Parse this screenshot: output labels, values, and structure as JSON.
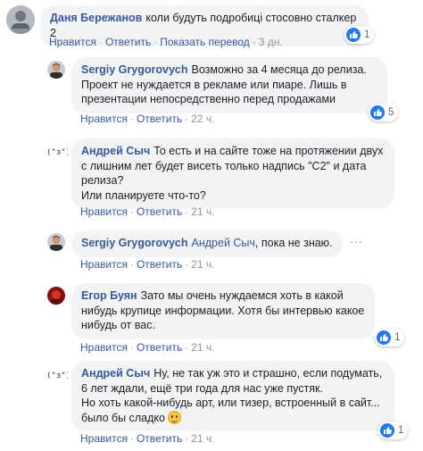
{
  "actions": {
    "like": "Нравится",
    "reply": "Ответить",
    "translate": "Показать перевод",
    "separator": "·"
  },
  "colors": {
    "link": "#385898",
    "like_badge": "#2078f4",
    "bubble": "#f2f3f5"
  },
  "comments": [
    {
      "author": "Даня Бережанов",
      "text": "коли будуть подробиці стосовно сталкер 2",
      "time": "3 дн.",
      "reactions": "1",
      "avatar": "gray-photo-avatar"
    },
    {
      "author": "Sergiy Grygorovych",
      "text": "Возможно за 4 месяца до релиза. Проект не нуждается в рекламе или пиаре. Лишь в презентации непосредственно перед продажами",
      "time": "22 ч.",
      "reactions": "5",
      "avatar": "man-photo-avatar"
    },
    {
      "author": "Андрей Сыч",
      "text": "То есть и на сайте тоже на протяжении двух с лишним лет будет висеть только надпись \"С2\" и дата релиза?\nИли планируете что-то?",
      "time": "21 ч.",
      "avatar": "ascii-face-avatar",
      "avatar_text": "(\"з\")"
    },
    {
      "author": "Sergiy Grygorovych",
      "mention": "Андрей Сыч",
      "text": ", пока не знаю.",
      "time": "21 ч.",
      "avatar": "man-photo-avatar"
    },
    {
      "author": "Егор Буян",
      "text": "Зато мы очень нуждаемся хоть в какой нибудь крупице информации. Хотя бы интервью какое нибудь от вас.",
      "time": "21 ч.",
      "reactions": "1",
      "avatar": "red-photo-avatar"
    },
    {
      "author": "Андрей Сыч",
      "text": "Ну, не так уж это и страшно, если подумать, 6 лет ждали, ещё три года для нас уже пустяк.\nНо хоть какой-нибудь арт, или тизер, встроенный в сайт... было бы сладко ",
      "emoji": "smile-emoji",
      "time": "21 ч.",
      "reactions": "1",
      "avatar": "ascii-face-avatar",
      "avatar_text": "(\"з\")"
    }
  ]
}
